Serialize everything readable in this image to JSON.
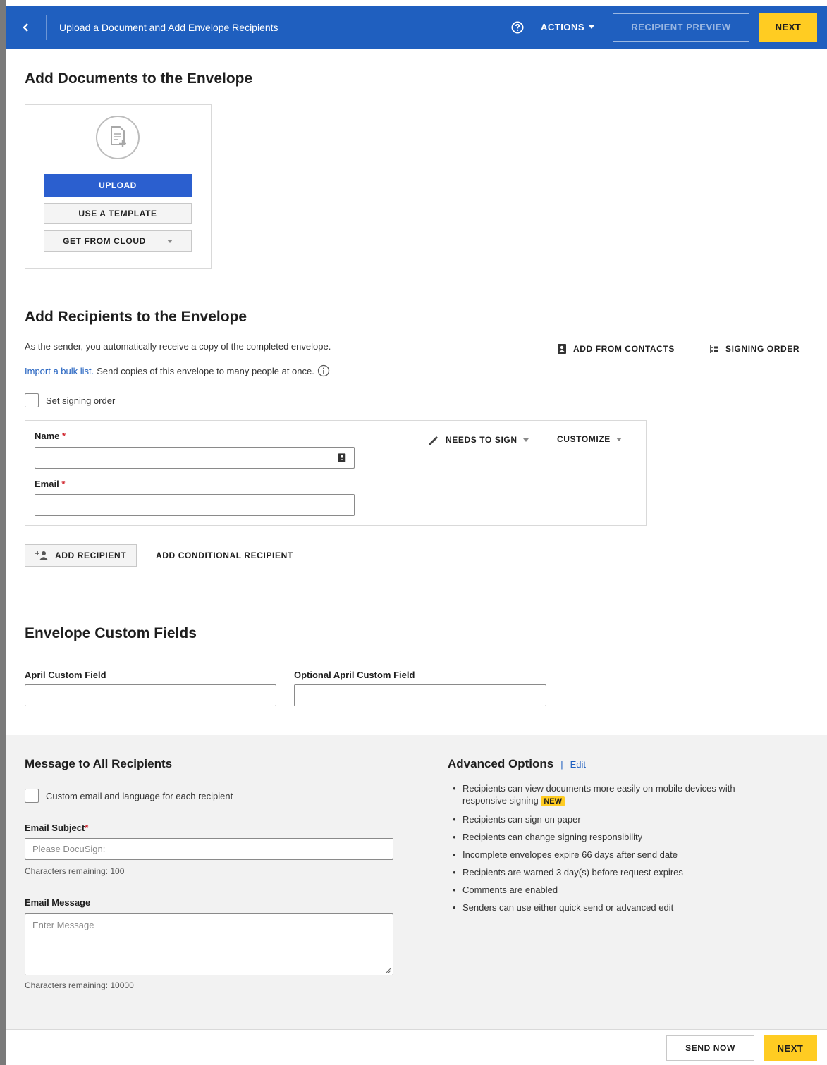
{
  "header": {
    "title": "Upload a Document and Add Envelope Recipients",
    "actions_label": "ACTIONS",
    "recipient_preview_label": "RECIPIENT PREVIEW",
    "next_label": "NEXT",
    "colors": {
      "bar": "#1f5fbf",
      "next": "#ffcc22"
    }
  },
  "documents": {
    "heading": "Add Documents to the Envelope",
    "upload_label": "UPLOAD",
    "template_label": "USE A TEMPLATE",
    "cloud_label": "GET FROM CLOUD"
  },
  "recipients": {
    "heading": "Add Recipients to the Envelope",
    "sender_note": "As the sender, you automatically receive a copy of the completed envelope.",
    "bulk_link": "Import a bulk list.",
    "bulk_text": "Send copies of this envelope to many people at once.",
    "add_from_contacts": "ADD FROM CONTACTS",
    "signing_order_btn": "SIGNING ORDER",
    "set_signing_order": "Set signing order",
    "name_label": "Name",
    "email_label": "Email",
    "required_mark": "*",
    "needs_to_sign": "NEEDS TO SIGN",
    "customize": "CUSTOMIZE",
    "add_recipient": "ADD RECIPIENT",
    "add_conditional": "ADD CONDITIONAL RECIPIENT"
  },
  "custom_fields": {
    "heading": "Envelope Custom Fields",
    "field1_label": "April Custom Field",
    "field2_label": "Optional April Custom Field"
  },
  "message": {
    "heading": "Message to All Recipients",
    "custom_email_label": "Custom email and language for each recipient",
    "subject_label": "Email Subject",
    "subject_required": "*",
    "subject_placeholder": "Please DocuSign:",
    "subject_remaining": "Characters remaining: 100",
    "message_label": "Email Message",
    "message_placeholder": "Enter Message",
    "message_remaining": "Characters remaining: 10000"
  },
  "advanced": {
    "heading": "Advanced Options",
    "separator": "|",
    "edit_link": "Edit",
    "items": [
      "Recipients can view documents more easily on mobile devices with responsive signing",
      "Recipients can sign on paper",
      "Recipients can change signing responsibility",
      "Incomplete envelopes expire 66 days after send date",
      "Recipients are warned 3 day(s) before request expires",
      "Comments are enabled",
      "Senders can use either quick send or advanced edit"
    ],
    "new_badge": "NEW"
  },
  "footer": {
    "send_now": "SEND NOW",
    "next": "NEXT"
  },
  "icons": [
    "chevron-left-icon",
    "help-icon",
    "chevron-down-icon",
    "document-add-icon",
    "contact-card-icon",
    "signing-order-icon",
    "info-icon",
    "pen-icon",
    "add-person-icon"
  ]
}
